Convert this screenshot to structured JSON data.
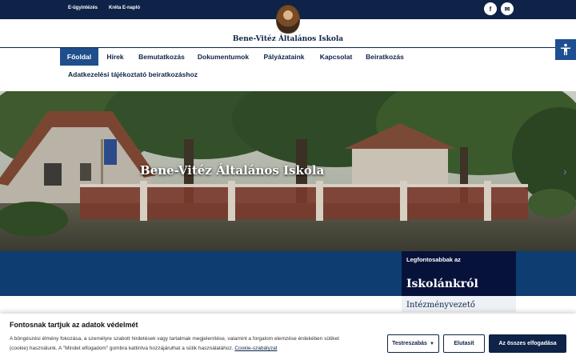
{
  "topbar": {
    "links": [
      "E-ügyintézés",
      "Kréta E-napló"
    ],
    "facebook_label": "f",
    "mail_label": "✉"
  },
  "header": {
    "school_name": "Bene-Vitéz Általános Iskola",
    "crest_icon": "school-crest",
    "accessibility_icon": "accessibility-icon"
  },
  "nav": {
    "items": [
      "Főoldal",
      "Hírek",
      "Bemutatkozás",
      "Dokumentumok",
      "Pályázataink",
      "Kapcsolat",
      "Beiratkozás"
    ],
    "second_row": "Adatkezelési tájékoztató beiratkozáshoz",
    "active_index": 0
  },
  "hero": {
    "title": "Bene-Vitéz Általános Iskola",
    "next_arrow": "›"
  },
  "sidebar_card": {
    "small_title": "Legfontosabbak az",
    "big_title": "Iskolánkról",
    "first_item": "Intézményvezető"
  },
  "cookie": {
    "title": "Fontosnak tartjuk az adatok védelmét",
    "text_line1": "A böngészési élmény fokozása, a személyre szabott hirdetések vagy tartalmak megjelenítése, valamint a forgalom elemzése érdekében sütiket",
    "text_line2": "(cookie) használunk. A \"Mindet elfogadom\" gombra kattintva hozzájárulhat a sütik használatához.",
    "policy_link": "Cookie-szabályzat",
    "customize_button": "Testreszabás",
    "reject_button": "Elutasít",
    "accept_button": "Az összes elfogadása"
  },
  "colors": {
    "navy": "#0e2347",
    "nav_active": "#1f4e8c",
    "band": "#0e3d72",
    "card": "#06123a"
  }
}
